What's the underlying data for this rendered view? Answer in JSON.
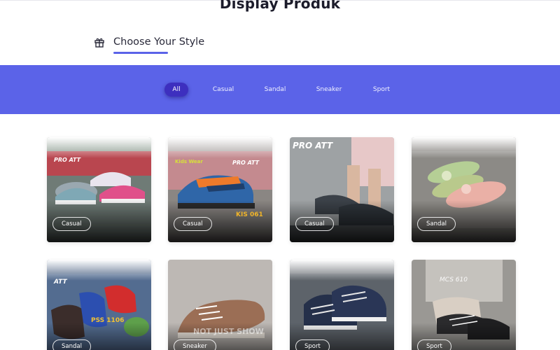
{
  "header": {
    "title": "Display Produk",
    "section_label": "Choose Your Style",
    "section_icon": "gift-icon"
  },
  "filters": [
    {
      "label": "All",
      "active": true
    },
    {
      "label": "Casual",
      "active": false
    },
    {
      "label": "Sandal",
      "active": false
    },
    {
      "label": "Sneaker",
      "active": false
    },
    {
      "label": "Sport",
      "active": false
    }
  ],
  "colors": {
    "accent": "#5b63e8",
    "active_pill": "#3d2fbf"
  },
  "products": [
    {
      "category": "Casual",
      "brand": "PRO ATT",
      "image": "pink and grey kids sneakers"
    },
    {
      "category": "Casual",
      "brand": "PRO ATT",
      "image": "blue and orange kids sneaker",
      "overlay_text": "KIS 061",
      "sub_brand": "Kids Wear"
    },
    {
      "category": "Casual",
      "brand": "PRO ATT",
      "image": "child wearing grey sneakers"
    },
    {
      "category": "Sandal",
      "brand": "",
      "image": "green and pink flower slides"
    },
    {
      "category": "Sandal",
      "brand": "ATT",
      "image": "slide sandals on denim",
      "overlay_text": "PSS 1106"
    },
    {
      "category": "Sneaker",
      "brand": "",
      "image": "brown canvas sneaker",
      "overlay_text": "NOT JUST SHOW"
    },
    {
      "category": "Sport",
      "brand": "",
      "image": "navy striped sport shoes"
    },
    {
      "category": "Sport",
      "brand": "",
      "image": "person tying black sport shoes",
      "overlay_text": "MCS 610"
    }
  ]
}
